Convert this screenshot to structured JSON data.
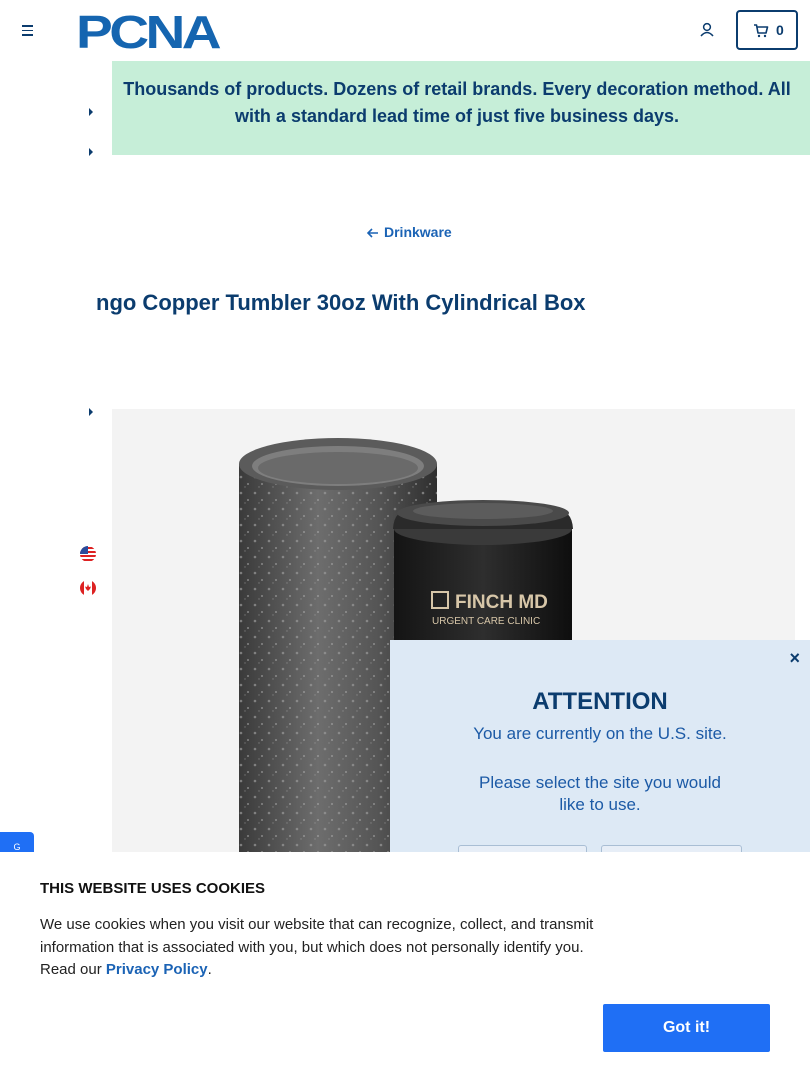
{
  "header": {
    "logo_text": "PCNA",
    "cart_count": "0"
  },
  "banner": {
    "text": "Thousands of products. Dozens of retail brands. Every decoration method. All with a standard lead time of just five business days."
  },
  "breadcrumb": {
    "label": "Drinkware"
  },
  "product": {
    "title": "ngo Copper Tumbler 30oz With Cylindrical Box",
    "imprint_brand": "FINCH MD",
    "imprint_sub": "URGENT CARE CLINIC"
  },
  "modal": {
    "close": "×",
    "title": "ATTENTION",
    "line1": "You are currently on the U.S. site.",
    "line2": "Please select the site you would like to use."
  },
  "cookie": {
    "title": "THIS WEBSITE USES COOKIES",
    "text": "We use cookies when you visit our website that can recognize, collect, and transmit information that is associated with you, but which does not personally identify you. Read our ",
    "link": "Privacy Policy",
    "end": ".",
    "button": "Got it!"
  },
  "side_tab": {
    "label": "G"
  },
  "colors": {
    "brand_navy": "#0b3c6e",
    "banner_green": "#c6eed8",
    "accent_blue": "#1f6ff5",
    "link_blue": "#1b63b5",
    "modal_bg": "#dde9f5"
  }
}
